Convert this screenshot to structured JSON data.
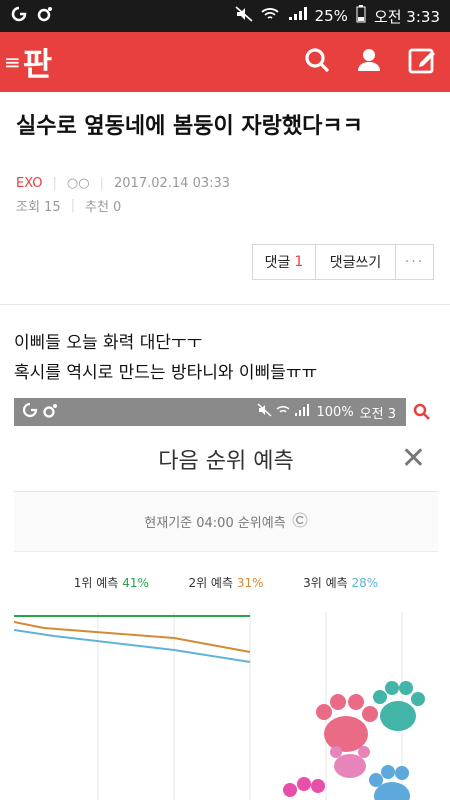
{
  "status_bar": {
    "battery": "25%",
    "time_label": "오전 3:33"
  },
  "app": {
    "logo_text": "판"
  },
  "post": {
    "title": "실수로 옆동네에 봄둥이 자랑했다ㅋㅋ",
    "author": "EXO",
    "author_alias": "○○",
    "datetime": "2017.02.14 03:33",
    "views": "조회 15",
    "recommends": "추천 0",
    "body_lines": [
      "이삐들 오늘 화력 대단ㅜㅜ",
      "혹시를 역시로 만드는 방타니와 이삐들ㅠㅠ"
    ]
  },
  "actions": {
    "comments_label": "댓글",
    "comments_count": "1",
    "write_comment": "댓글쓰기",
    "more": "···"
  },
  "embedded": {
    "battery": "100%",
    "time_label": "오전 3",
    "title": "다음 순위 예측",
    "sub": "현재기준 04:00 순위예측",
    "legend": [
      {
        "label": "1위 예측",
        "pct": "41%"
      },
      {
        "label": "2위 예측",
        "pct": "31%"
      },
      {
        "label": "3위 예측",
        "pct": "28%"
      }
    ]
  },
  "colors": {
    "accent": "#e8403f",
    "green": "#2aa24b",
    "orange": "#d28a35",
    "blue": "#5fb3d6"
  }
}
